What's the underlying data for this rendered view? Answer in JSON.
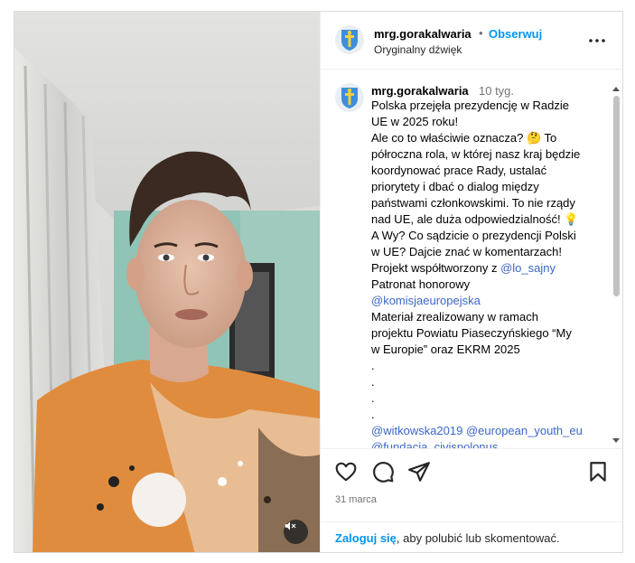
{
  "post": {
    "username": "mrg.gorakalwaria",
    "follow_label": "Obserwuj",
    "audio_label": "Oryginalny dźwięk",
    "more_icon": "more-horizontal-icon",
    "avatar_icon": "coat-of-arms-icon"
  },
  "comment": {
    "username": "mrg.gorakalwaria",
    "time_ago": "10 tyg.",
    "lines": [
      "Polska przejęła prezydencję w Radzie",
      "UE w 2025 roku!",
      "Ale co to właściwie oznacza? 🤔 To",
      "półroczna rola, w której nasz kraj będzie",
      "koordynować prace Rady, ustalać",
      "priorytety i dbać o dialog między",
      "państwami członkowskimi. To nie rządy",
      "nad UE, ale duża odpowiedzialność! 💡",
      "A Wy? Co sądzicie o prezydencji Polski",
      "w UE? Dajcie znać w komentarzach!"
    ],
    "coauthor_prefix": "Projekt współtworzony z ",
    "coauthor_mention": "@lo_sajny",
    "patronage_label": "Patronat honorowy",
    "patronage_mention": "@komisjaeuropejska",
    "project_lines": [
      "Materiał zrealizowany w ramach",
      "projektu Powiatu Piaseczyńskiego “My",
      "w Europie” oraz EKRM 2025"
    ],
    "dots": [
      ".",
      ".",
      ".",
      "."
    ],
    "mention_1": "@witkowska2019",
    "mention_2": "@european_youth_eu",
    "mention_3": "@fundacja_civispolonus"
  },
  "actions": {
    "like_icon": "heart-icon",
    "comment_icon": "comment-bubble-icon",
    "share_icon": "paper-plane-icon",
    "save_icon": "bookmark-icon",
    "date": "31 marca",
    "login_link": "Zaloguj się",
    "login_rest": ", aby polubić lub skomentować."
  },
  "media": {
    "mute_icon": "speaker-muted-icon"
  },
  "colors": {
    "accent": "#0095f6",
    "mention": "#00376b",
    "muted_text": "#737373",
    "border": "#dbdbdb"
  }
}
